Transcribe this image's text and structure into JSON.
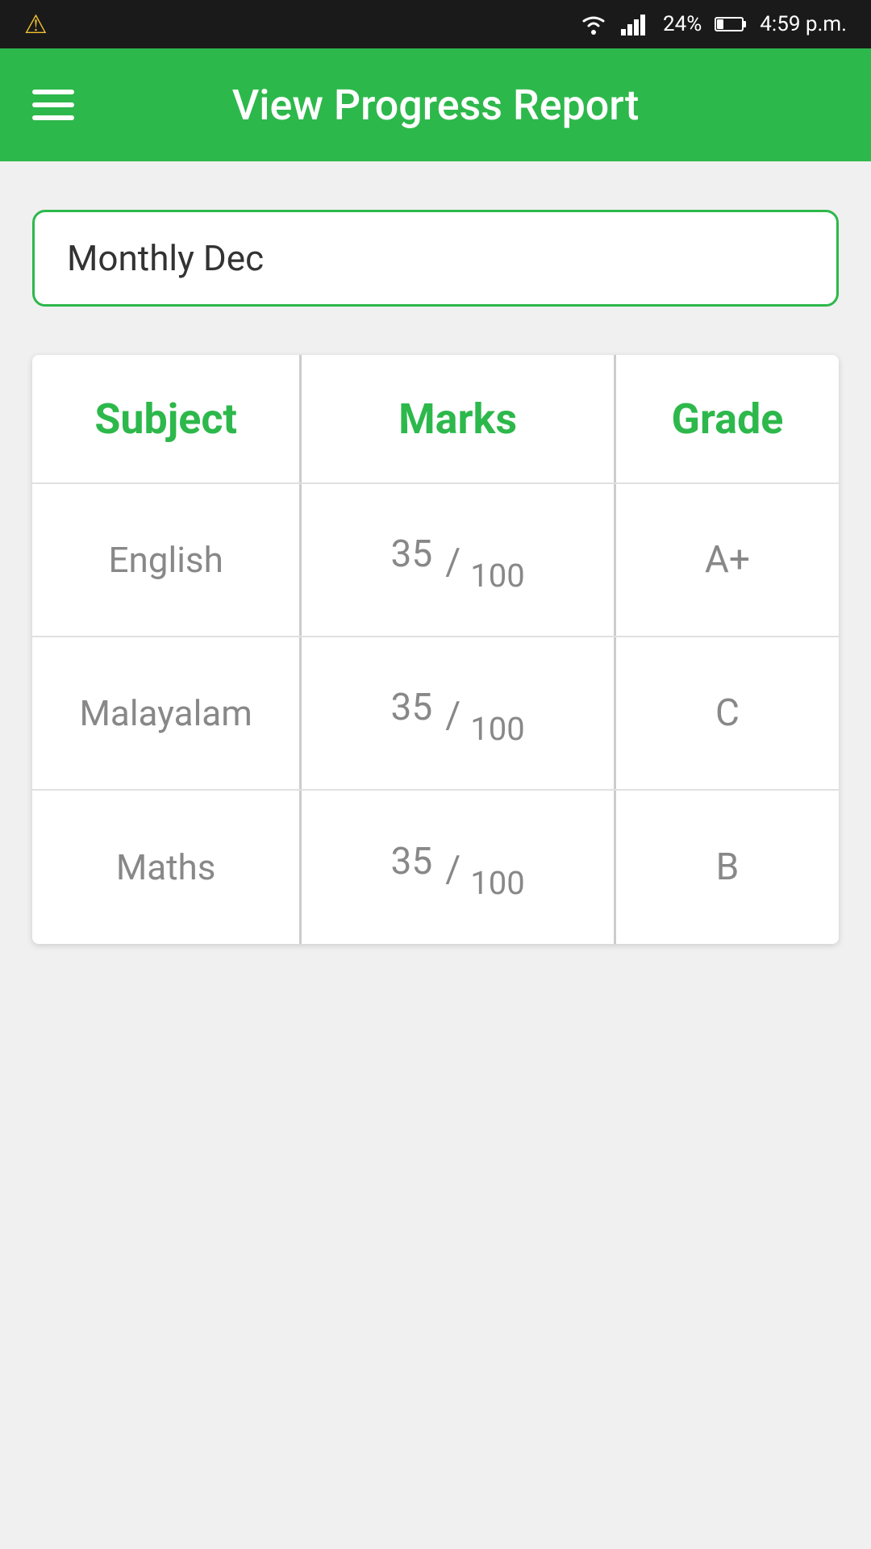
{
  "statusBar": {
    "warning": "⚠",
    "battery": "24%",
    "time": "4:59 p.m."
  },
  "appBar": {
    "menuIcon": "hamburger",
    "title": "View Progress Report"
  },
  "reportField": {
    "value": "Monthly Dec"
  },
  "table": {
    "headers": {
      "subject": "Subject",
      "marks": "Marks",
      "grade": "Grade"
    },
    "rows": [
      {
        "subject": "English",
        "marks": "35",
        "total": "100",
        "grade": "A+"
      },
      {
        "subject": "Malayalam",
        "marks": "35",
        "total": "100",
        "grade": "C"
      },
      {
        "subject": "Maths",
        "marks": "35",
        "total": "100",
        "grade": "B"
      }
    ]
  }
}
